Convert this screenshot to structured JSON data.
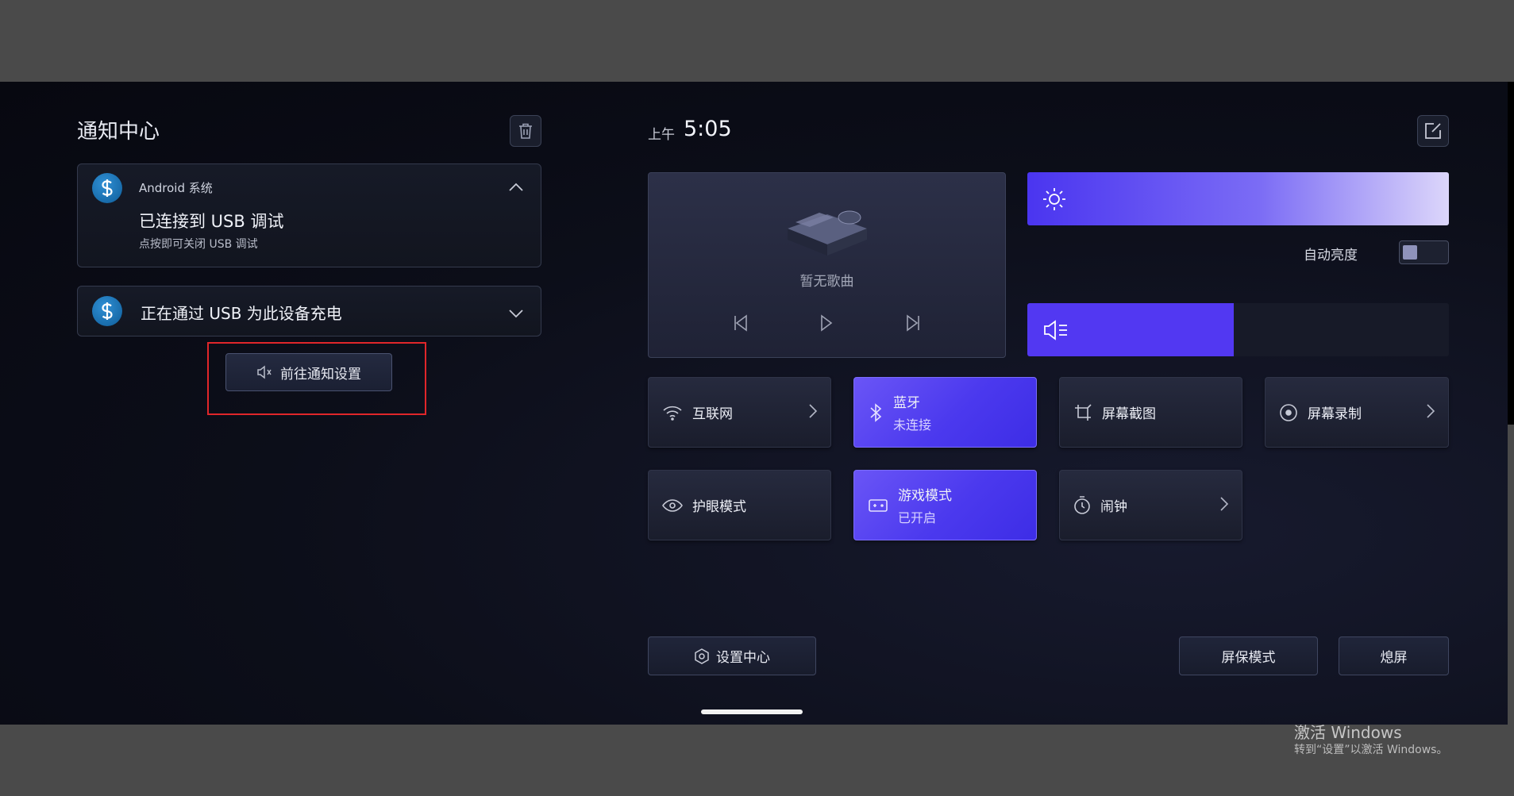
{
  "notification_center": {
    "title": "通知中心",
    "notifications": [
      {
        "app_name": "Android 系统",
        "title": "已连接到 USB 调试",
        "subtitle": "点按即可关闭 USB 调试",
        "icon": "android-system-icon",
        "expanded": true
      },
      {
        "title": "正在通过 USB 为此设备充电",
        "icon": "android-system-icon",
        "expanded": false
      }
    ],
    "goto_settings_label": "前往通知设置"
  },
  "status": {
    "ampm": "上午",
    "time": "5:05"
  },
  "media": {
    "no_song_text": "暂无歌曲"
  },
  "brightness": {
    "level": 1.0,
    "auto_label": "自动亮度",
    "auto_enabled": false
  },
  "volume": {
    "level": 0.49
  },
  "tiles": [
    {
      "label": "互联网",
      "icon": "wifi-icon",
      "active": false,
      "chevron": true
    },
    {
      "label": "蓝牙",
      "sub": "未连接",
      "icon": "bluetooth-icon",
      "active": true,
      "chevron": false
    },
    {
      "label": "屏幕截图",
      "icon": "crop-icon",
      "active": false,
      "chevron": false
    },
    {
      "label": "屏幕录制",
      "icon": "record-icon",
      "active": false,
      "chevron": true
    },
    {
      "label": "护眼模式",
      "icon": "eye-icon",
      "active": false,
      "chevron": false
    },
    {
      "label": "游戏模式",
      "sub": "已开启",
      "icon": "gamepad-icon",
      "active": true,
      "chevron": false
    },
    {
      "label": "闹钟",
      "icon": "alarm-icon",
      "active": false,
      "chevron": true
    }
  ],
  "bottom": {
    "settings_center": "设置中心",
    "screensaver": "屏保模式",
    "screen_off": "熄屏"
  },
  "watermark": {
    "title": "激活 Windows",
    "subtitle": "转到“设置”以激活 Windows。"
  },
  "colors": {
    "accent": "#5238f2",
    "annotation": "#e0262a",
    "background": "#0c0e19"
  }
}
